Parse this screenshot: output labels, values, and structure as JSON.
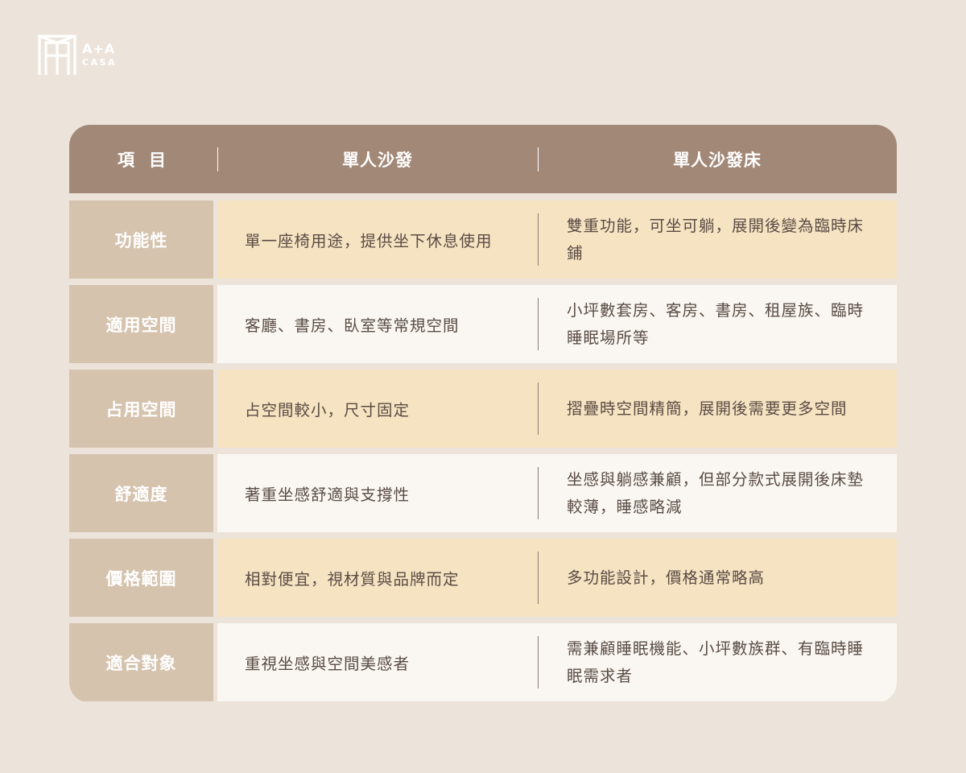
{
  "logo": {
    "line1": "A+A",
    "line2": "CASA"
  },
  "table": {
    "headers": {
      "item": "項目",
      "sofa": "單人沙發",
      "bed": "單人沙發床"
    },
    "rows": [
      {
        "label": "功能性",
        "sofa": "單一座椅用途，提供坐下休息使用",
        "bed": "雙重功能，可坐可躺，展開後變為臨時床鋪"
      },
      {
        "label": "適用空間",
        "sofa": "客廳、書房、臥室等常規空間",
        "bed": "小坪數套房、客房、書房、租屋族、臨時睡眠場所等"
      },
      {
        "label": "占用空間",
        "sofa": "占空間較小，尺寸固定",
        "bed": "摺疊時空間精簡，展開後需要更多空間"
      },
      {
        "label": "舒適度",
        "sofa": "著重坐感舒適與支撐性",
        "bed": "坐感與躺感兼顧，但部分款式展開後床墊較薄，睡感略減"
      },
      {
        "label": "價格範圍",
        "sofa": "相對便宜，視材質與品牌而定",
        "bed": "多功能設計，價格通常略高"
      },
      {
        "label": "適合對象",
        "sofa": "重視坐感與空間美感者",
        "bed": "需兼顧睡眠機能、小坪數族群、有臨時睡眠需求者"
      }
    ]
  }
}
